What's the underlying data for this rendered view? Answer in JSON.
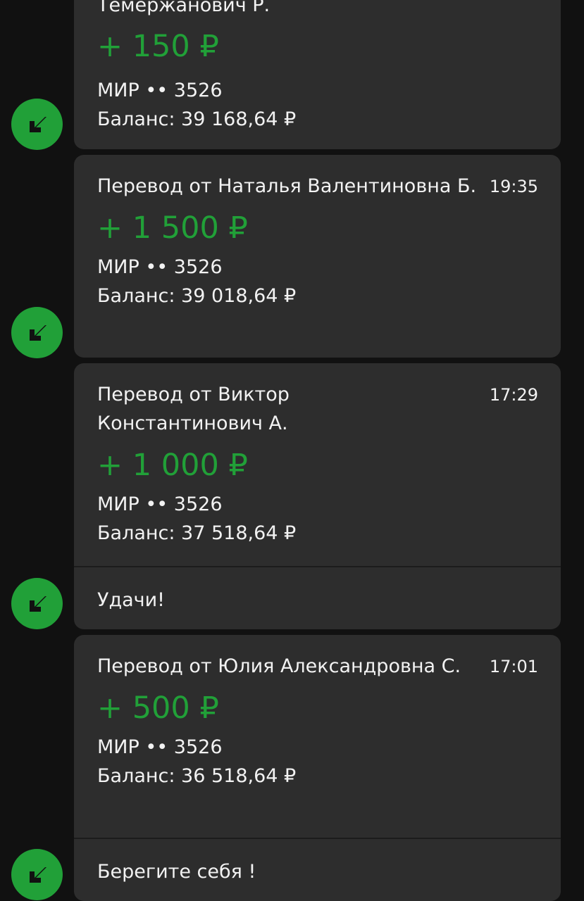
{
  "messages": [
    {
      "title_tail": "Темержанович Р.",
      "time": "",
      "amount": "+ 150 ₽",
      "card": "МИР •• 3526",
      "balance": "Баланс: 39 168,64 ₽",
      "note": ""
    },
    {
      "title": "Перевод от Наталья Валентиновна Б.",
      "time": "19:35",
      "amount": "+ 1 500 ₽",
      "card": "МИР •• 3526",
      "balance": "Баланс: 39 018,64 ₽",
      "note": ""
    },
    {
      "title": "Перевод от Виктор Константинович А.",
      "time": "17:29",
      "amount": "+ 1 000 ₽",
      "card": "МИР •• 3526",
      "balance": "Баланс: 37 518,64 ₽",
      "note": "Удачи!"
    },
    {
      "title": "Перевод от Юлия Александровна С.",
      "time": "17:01",
      "amount": "+ 500 ₽",
      "card": "МИР •• 3526",
      "balance": "Баланс: 36 518,64 ₽",
      "note": "Берегите себя !"
    }
  ],
  "avatar_icon": "incoming-arrow-icon",
  "colors": {
    "background": "#111111",
    "bubble": "#2d2d2d",
    "accent_green": "#21a038",
    "text": "#f2f2f2"
  }
}
